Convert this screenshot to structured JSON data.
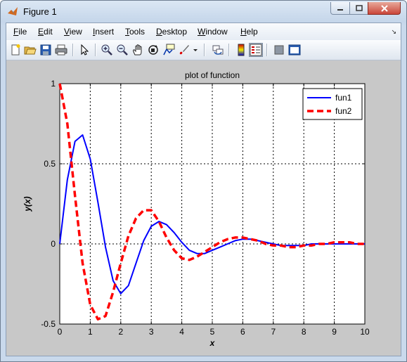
{
  "window": {
    "title": "Figure 1",
    "controls": {
      "minimize": "▭",
      "maximize": "□",
      "close": "✕"
    }
  },
  "menu": [
    {
      "pre": "",
      "u": "F",
      "post": "ile"
    },
    {
      "pre": "",
      "u": "E",
      "post": "dit"
    },
    {
      "pre": "",
      "u": "V",
      "post": "iew"
    },
    {
      "pre": "",
      "u": "I",
      "post": "nsert"
    },
    {
      "pre": "",
      "u": "T",
      "post": "ools"
    },
    {
      "pre": "",
      "u": "D",
      "post": "esktop"
    },
    {
      "pre": "",
      "u": "W",
      "post": "indow"
    },
    {
      "pre": "",
      "u": "H",
      "post": "elp"
    }
  ],
  "menu_overflow": "↘",
  "toolbar": [
    "new-figure-icon",
    "open-file-icon",
    "save-icon",
    "print-icon",
    "edit-plot-arrow-icon",
    "zoom-in-icon",
    "zoom-out-icon",
    "pan-hand-icon",
    "rotate-3d-icon",
    "data-cursor-icon",
    "brush-icon",
    "link-plot-icon",
    "colorbar-icon",
    "legend-icon",
    "hide-plot-tools-icon",
    "show-plot-tools-icon"
  ],
  "chart_data": {
    "type": "line",
    "title": "plot of function",
    "xlabel": "x",
    "ylabel": "y(x)",
    "xlim": [
      0,
      10
    ],
    "ylim": [
      -0.5,
      1
    ],
    "xticks": [
      "0",
      "1",
      "2",
      "3",
      "4",
      "5",
      "6",
      "7",
      "8",
      "9",
      "10"
    ],
    "yticks": [
      "-0.5",
      "0",
      "0.5",
      "1"
    ],
    "grid": "dotted",
    "legend_position": "top-right",
    "series": [
      {
        "name": "fun1",
        "color": "#0000ff",
        "style": "solid",
        "x": [
          0,
          0.25,
          0.5,
          0.75,
          1,
          1.25,
          1.5,
          1.75,
          2,
          2.25,
          2.5,
          2.75,
          3,
          3.25,
          3.5,
          3.75,
          4,
          4.25,
          4.5,
          4.75,
          5,
          5.25,
          5.5,
          5.75,
          6,
          6.25,
          6.5,
          6.75,
          7,
          7.25,
          7.5,
          7.75,
          8,
          8.25,
          8.5,
          8.75,
          9,
          9.25,
          9.5,
          9.75,
          10
        ],
        "y": [
          0,
          0.4,
          0.64,
          0.68,
          0.53,
          0.26,
          -0.02,
          -0.23,
          -0.31,
          -0.26,
          -0.12,
          0.02,
          0.11,
          0.14,
          0.12,
          0.07,
          0.01,
          -0.04,
          -0.06,
          -0.06,
          -0.04,
          -0.02,
          0.0,
          0.02,
          0.03,
          0.03,
          0.02,
          0.01,
          0.0,
          -0.01,
          -0.01,
          -0.01,
          -0.01,
          0.0,
          0.0,
          0.0,
          0.0,
          0.0,
          0.0,
          0.0,
          0.0
        ]
      },
      {
        "name": "fun2",
        "color": "#ff0000",
        "style": "dashed",
        "x": [
          0,
          0.25,
          0.5,
          0.75,
          1,
          1.25,
          1.5,
          1.75,
          2,
          2.25,
          2.5,
          2.75,
          3,
          3.25,
          3.5,
          3.75,
          4,
          4.25,
          4.5,
          4.75,
          5,
          5.25,
          5.5,
          5.75,
          6,
          6.25,
          6.5,
          6.75,
          7,
          7.25,
          7.5,
          7.75,
          8,
          8.25,
          8.5,
          8.75,
          9,
          9.25,
          9.5,
          9.75,
          10
        ],
        "y": [
          1,
          0.75,
          0.3,
          -0.12,
          -0.38,
          -0.47,
          -0.45,
          -0.3,
          -0.12,
          0.05,
          0.16,
          0.21,
          0.21,
          0.14,
          0.04,
          -0.04,
          -0.09,
          -0.1,
          -0.08,
          -0.05,
          -0.02,
          0.01,
          0.03,
          0.04,
          0.04,
          0.03,
          0.02,
          0.0,
          -0.01,
          -0.01,
          -0.02,
          -0.02,
          -0.01,
          -0.01,
          0.0,
          0.0,
          0.01,
          0.01,
          0.01,
          0.0,
          0.0
        ]
      }
    ]
  }
}
